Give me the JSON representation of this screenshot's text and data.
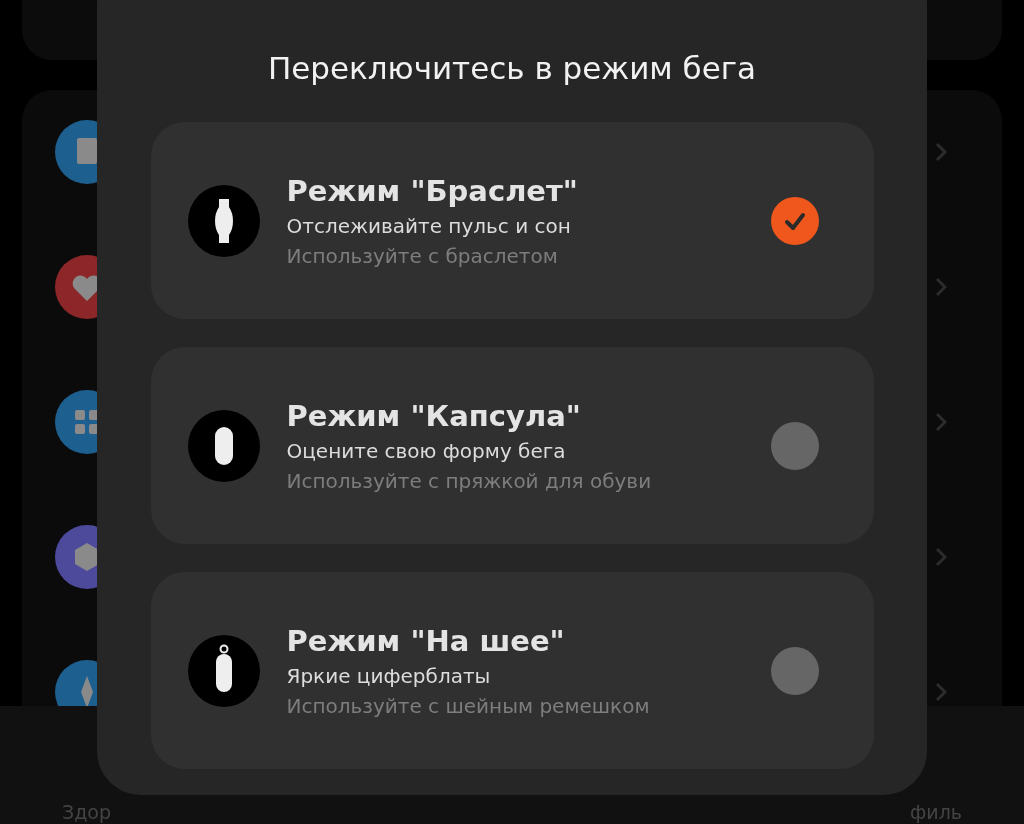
{
  "background": {
    "icons": [
      {
        "kind": "file",
        "color": "#1d5f8e"
      },
      {
        "kind": "heart",
        "color": "#8c2628"
      },
      {
        "kind": "grid",
        "color": "#1d5f8e"
      },
      {
        "kind": "hexagon",
        "color": "#4d4a9c"
      },
      {
        "kind": "compass",
        "color": "#1d5f8e"
      }
    ],
    "tabs": [
      {
        "label": "Здор"
      },
      {
        "label": "филь"
      }
    ]
  },
  "dialog": {
    "title": "Переключитесь в режим бега",
    "modes": [
      {
        "kind": "band",
        "title": "Режим \"Браслет\"",
        "description": "Отслеживайте пульс и сон",
        "usage": "Используйте с браслетом",
        "selected": true
      },
      {
        "kind": "capsule",
        "title": "Режим \"Капсула\"",
        "description": "Оцените свою форму бега",
        "usage": "Используйте с пряжкой для обуви",
        "selected": false
      },
      {
        "kind": "neck",
        "title": "Режим \"На шее\"",
        "description": "Яркие циферблаты",
        "usage": "Используйте с шейным ремешком",
        "selected": false
      }
    ]
  }
}
